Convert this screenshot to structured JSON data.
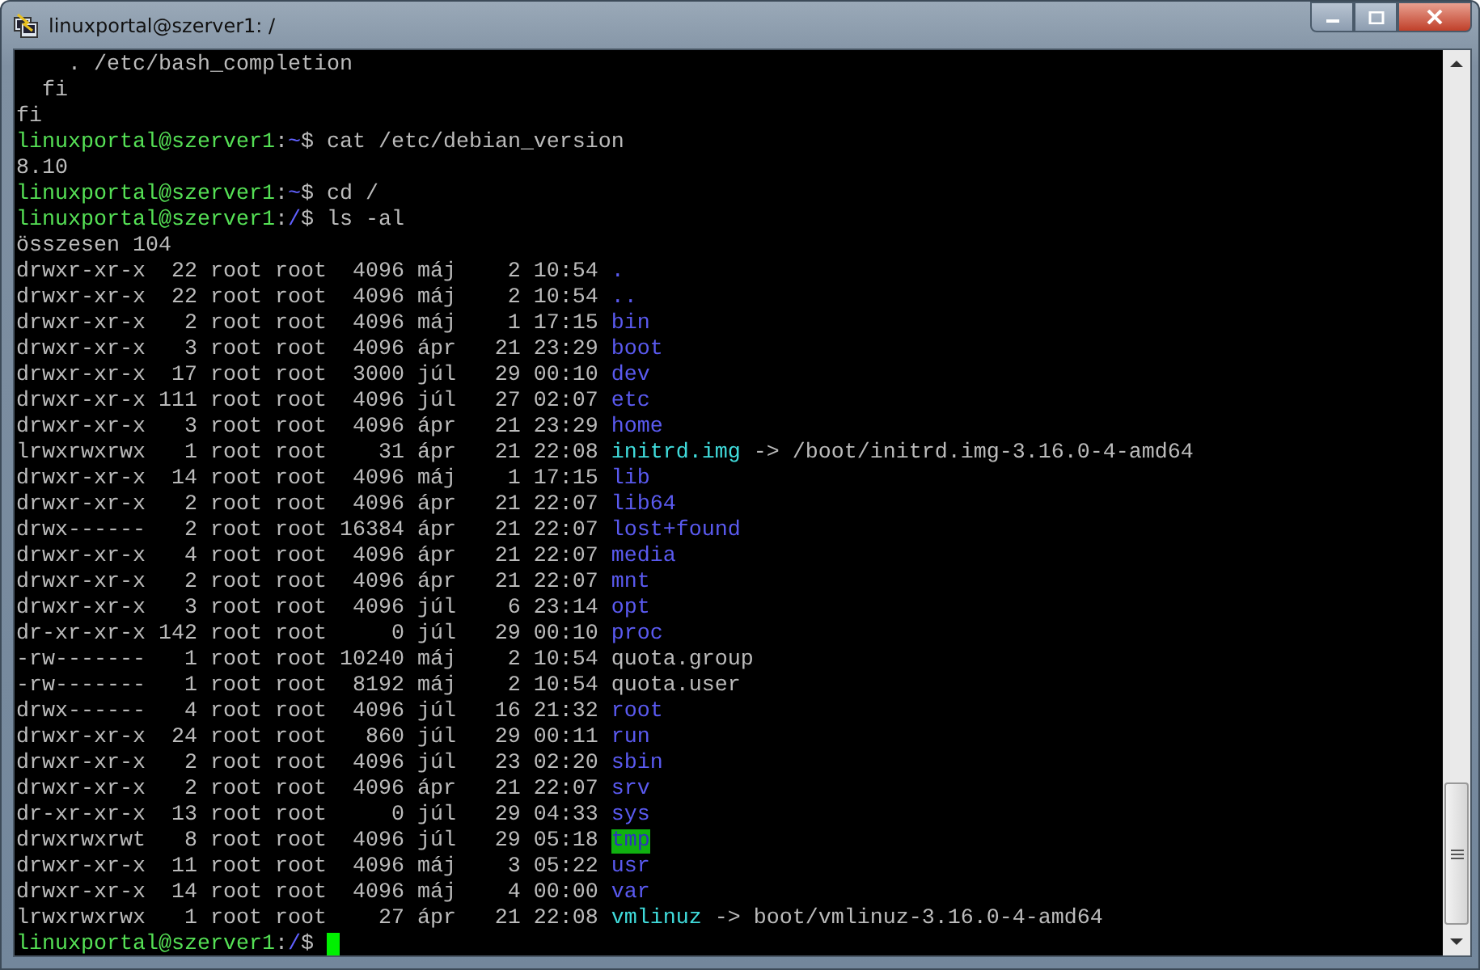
{
  "window": {
    "title": "linuxportal@szerver1: /"
  },
  "lines": [
    {
      "segments": [
        {
          "text": "    . /etc/bash_completion",
          "kind": "plain"
        }
      ]
    },
    {
      "segments": [
        {
          "text": "  fi",
          "kind": "plain"
        }
      ]
    },
    {
      "segments": [
        {
          "text": "fi",
          "kind": "plain"
        }
      ]
    },
    {
      "segments": [
        {
          "text": "linuxportal@szerver1",
          "kind": "user"
        },
        {
          "text": ":",
          "kind": "plain"
        },
        {
          "text": "~",
          "kind": "path"
        },
        {
          "text": "$ cat /etc/debian_version",
          "kind": "plain"
        }
      ]
    },
    {
      "segments": [
        {
          "text": "8.10",
          "kind": "plain"
        }
      ]
    },
    {
      "segments": [
        {
          "text": "linuxportal@szerver1",
          "kind": "user"
        },
        {
          "text": ":",
          "kind": "plain"
        },
        {
          "text": "~",
          "kind": "path"
        },
        {
          "text": "$ cd /",
          "kind": "plain"
        }
      ]
    },
    {
      "segments": [
        {
          "text": "linuxportal@szerver1",
          "kind": "user"
        },
        {
          "text": ":",
          "kind": "plain"
        },
        {
          "text": "/",
          "kind": "path"
        },
        {
          "text": "$ ls -al",
          "kind": "plain"
        }
      ]
    },
    {
      "segments": [
        {
          "text": "összesen 104",
          "kind": "plain"
        }
      ]
    },
    {
      "segments": [
        {
          "text": "drwxr-xr-x  22 root root  4096 máj    2 10:54 ",
          "kind": "plain"
        },
        {
          "text": ".",
          "kind": "dir"
        }
      ]
    },
    {
      "segments": [
        {
          "text": "drwxr-xr-x  22 root root  4096 máj    2 10:54 ",
          "kind": "plain"
        },
        {
          "text": "..",
          "kind": "dir"
        }
      ]
    },
    {
      "segments": [
        {
          "text": "drwxr-xr-x   2 root root  4096 máj    1 17:15 ",
          "kind": "plain"
        },
        {
          "text": "bin",
          "kind": "dir"
        }
      ]
    },
    {
      "segments": [
        {
          "text": "drwxr-xr-x   3 root root  4096 ápr   21 23:29 ",
          "kind": "plain"
        },
        {
          "text": "boot",
          "kind": "dir"
        }
      ]
    },
    {
      "segments": [
        {
          "text": "drwxr-xr-x  17 root root  3000 júl   29 00:10 ",
          "kind": "plain"
        },
        {
          "text": "dev",
          "kind": "dir"
        }
      ]
    },
    {
      "segments": [
        {
          "text": "drwxr-xr-x 111 root root  4096 júl   27 02:07 ",
          "kind": "plain"
        },
        {
          "text": "etc",
          "kind": "dir"
        }
      ]
    },
    {
      "segments": [
        {
          "text": "drwxr-xr-x   3 root root  4096 ápr   21 23:29 ",
          "kind": "plain"
        },
        {
          "text": "home",
          "kind": "dir"
        }
      ]
    },
    {
      "segments": [
        {
          "text": "lrwxrwxrwx   1 root root    31 ápr   21 22:08 ",
          "kind": "plain"
        },
        {
          "text": "initrd.img",
          "kind": "link"
        },
        {
          "text": " -> /boot/initrd.img-3.16.0-4-amd64",
          "kind": "plain"
        }
      ]
    },
    {
      "segments": [
        {
          "text": "drwxr-xr-x  14 root root  4096 máj    1 17:15 ",
          "kind": "plain"
        },
        {
          "text": "lib",
          "kind": "dir"
        }
      ]
    },
    {
      "segments": [
        {
          "text": "drwxr-xr-x   2 root root  4096 ápr   21 22:07 ",
          "kind": "plain"
        },
        {
          "text": "lib64",
          "kind": "dir"
        }
      ]
    },
    {
      "segments": [
        {
          "text": "drwx------   2 root root 16384 ápr   21 22:07 ",
          "kind": "plain"
        },
        {
          "text": "lost+found",
          "kind": "dir"
        }
      ]
    },
    {
      "segments": [
        {
          "text": "drwxr-xr-x   4 root root  4096 ápr   21 22:07 ",
          "kind": "plain"
        },
        {
          "text": "media",
          "kind": "dir"
        }
      ]
    },
    {
      "segments": [
        {
          "text": "drwxr-xr-x   2 root root  4096 ápr   21 22:07 ",
          "kind": "plain"
        },
        {
          "text": "mnt",
          "kind": "dir"
        }
      ]
    },
    {
      "segments": [
        {
          "text": "drwxr-xr-x   3 root root  4096 júl    6 23:14 ",
          "kind": "plain"
        },
        {
          "text": "opt",
          "kind": "dir"
        }
      ]
    },
    {
      "segments": [
        {
          "text": "dr-xr-xr-x 142 root root     0 júl   29 00:10 ",
          "kind": "plain"
        },
        {
          "text": "proc",
          "kind": "dir"
        }
      ]
    },
    {
      "segments": [
        {
          "text": "-rw-------   1 root root 10240 máj    2 10:54 quota.group",
          "kind": "plain"
        }
      ]
    },
    {
      "segments": [
        {
          "text": "-rw-------   1 root root  8192 máj    2 10:54 quota.user",
          "kind": "plain"
        }
      ]
    },
    {
      "segments": [
        {
          "text": "drwx------   4 root root  4096 júl   16 21:32 ",
          "kind": "plain"
        },
        {
          "text": "root",
          "kind": "dir"
        }
      ]
    },
    {
      "segments": [
        {
          "text": "drwxr-xr-x  24 root root   860 júl   29 00:11 ",
          "kind": "plain"
        },
        {
          "text": "run",
          "kind": "dir"
        }
      ]
    },
    {
      "segments": [
        {
          "text": "drwxr-xr-x   2 root root  4096 júl   23 02:20 ",
          "kind": "plain"
        },
        {
          "text": "sbin",
          "kind": "dir"
        }
      ]
    },
    {
      "segments": [
        {
          "text": "drwxr-xr-x   2 root root  4096 ápr   21 22:07 ",
          "kind": "plain"
        },
        {
          "text": "srv",
          "kind": "dir"
        }
      ]
    },
    {
      "segments": [
        {
          "text": "dr-xr-xr-x  13 root root     0 júl   29 04:33 ",
          "kind": "plain"
        },
        {
          "text": "sys",
          "kind": "dir"
        }
      ]
    },
    {
      "segments": [
        {
          "text": "drwxrwxrwt   8 root root  4096 júl   29 05:18 ",
          "kind": "plain"
        },
        {
          "text": "tmp",
          "kind": "sticky"
        }
      ]
    },
    {
      "segments": [
        {
          "text": "drwxr-xr-x  11 root root  4096 máj    3 05:22 ",
          "kind": "plain"
        },
        {
          "text": "usr",
          "kind": "dir"
        }
      ]
    },
    {
      "segments": [
        {
          "text": "drwxr-xr-x  14 root root  4096 máj    4 00:00 ",
          "kind": "plain"
        },
        {
          "text": "var",
          "kind": "dir"
        }
      ]
    },
    {
      "segments": [
        {
          "text": "lrwxrwxrwx   1 root root    27 ápr   21 22:08 ",
          "kind": "plain"
        },
        {
          "text": "vmlinuz",
          "kind": "link"
        },
        {
          "text": " -> boot/vmlinuz-3.16.0-4-amd64",
          "kind": "plain"
        }
      ]
    },
    {
      "segments": [
        {
          "text": "linuxportal@szerver1",
          "kind": "user"
        },
        {
          "text": ":",
          "kind": "plain"
        },
        {
          "text": "/",
          "kind": "path"
        },
        {
          "text": "$ ",
          "kind": "plain"
        },
        {
          "kind": "cursor"
        }
      ]
    }
  ]
}
